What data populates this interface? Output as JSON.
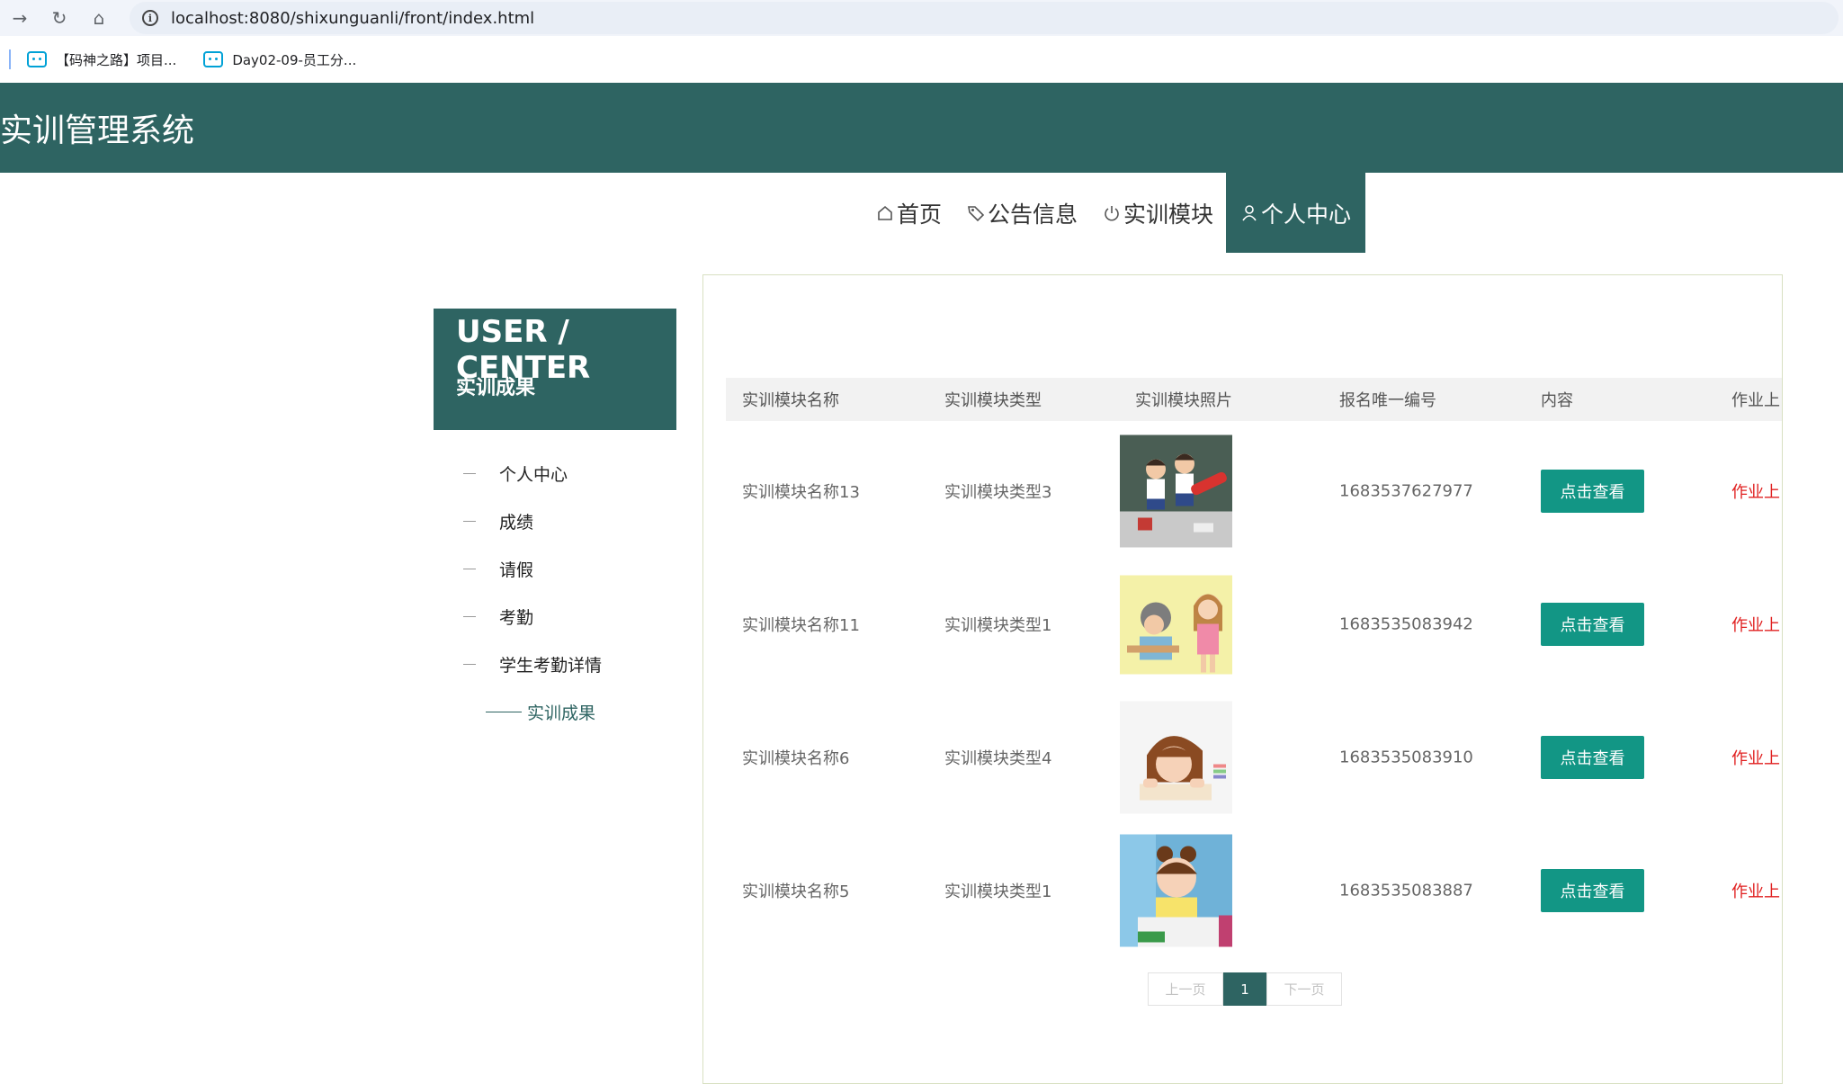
{
  "browser": {
    "url": "localhost:8080/shixunguanli/front/index.html",
    "bookmarks": [
      {
        "label": "【码神之路】项目..."
      },
      {
        "label": "Day02-09-员工分..."
      }
    ]
  },
  "header": {
    "title": "实训管理系统"
  },
  "nav": {
    "items": [
      {
        "label": "首页",
        "icon": "home-icon"
      },
      {
        "label": "公告信息",
        "icon": "tag-icon"
      },
      {
        "label": "实训模块",
        "icon": "power-icon"
      },
      {
        "label": "个人中心",
        "icon": "user-icon",
        "active": true
      }
    ]
  },
  "side": {
    "title": "USER / CENTER",
    "subtitle": "实训成果",
    "items": [
      {
        "label": "个人中心"
      },
      {
        "label": "成绩"
      },
      {
        "label": "请假"
      },
      {
        "label": "考勤"
      },
      {
        "label": "学生考勤详情"
      },
      {
        "label": "实训成果",
        "active": true
      }
    ]
  },
  "table": {
    "columns": [
      "实训模块名称",
      "实训模块类型",
      "实训模块照片",
      "报名唯一编号",
      "内容",
      "作业上"
    ],
    "rows": [
      {
        "name": "实训模块名称13",
        "type": "实训模块类型3",
        "number": "1683537627977",
        "action": "点击查看",
        "homework": "作业上"
      },
      {
        "name": "实训模块名称11",
        "type": "实训模块类型1",
        "number": "1683535083942",
        "action": "点击查看",
        "homework": "作业上"
      },
      {
        "name": "实训模块名称6",
        "type": "实训模块类型4",
        "number": "1683535083910",
        "action": "点击查看",
        "homework": "作业上"
      },
      {
        "name": "实训模块名称5",
        "type": "实训模块类型1",
        "number": "1683535083887",
        "action": "点击查看",
        "homework": "作业上"
      }
    ]
  },
  "pagination": {
    "prev": "上一页",
    "current": "1",
    "next": "下一页"
  },
  "colors": {
    "primary": "#2e6462",
    "button": "#129685",
    "link_red": "#e02020"
  }
}
